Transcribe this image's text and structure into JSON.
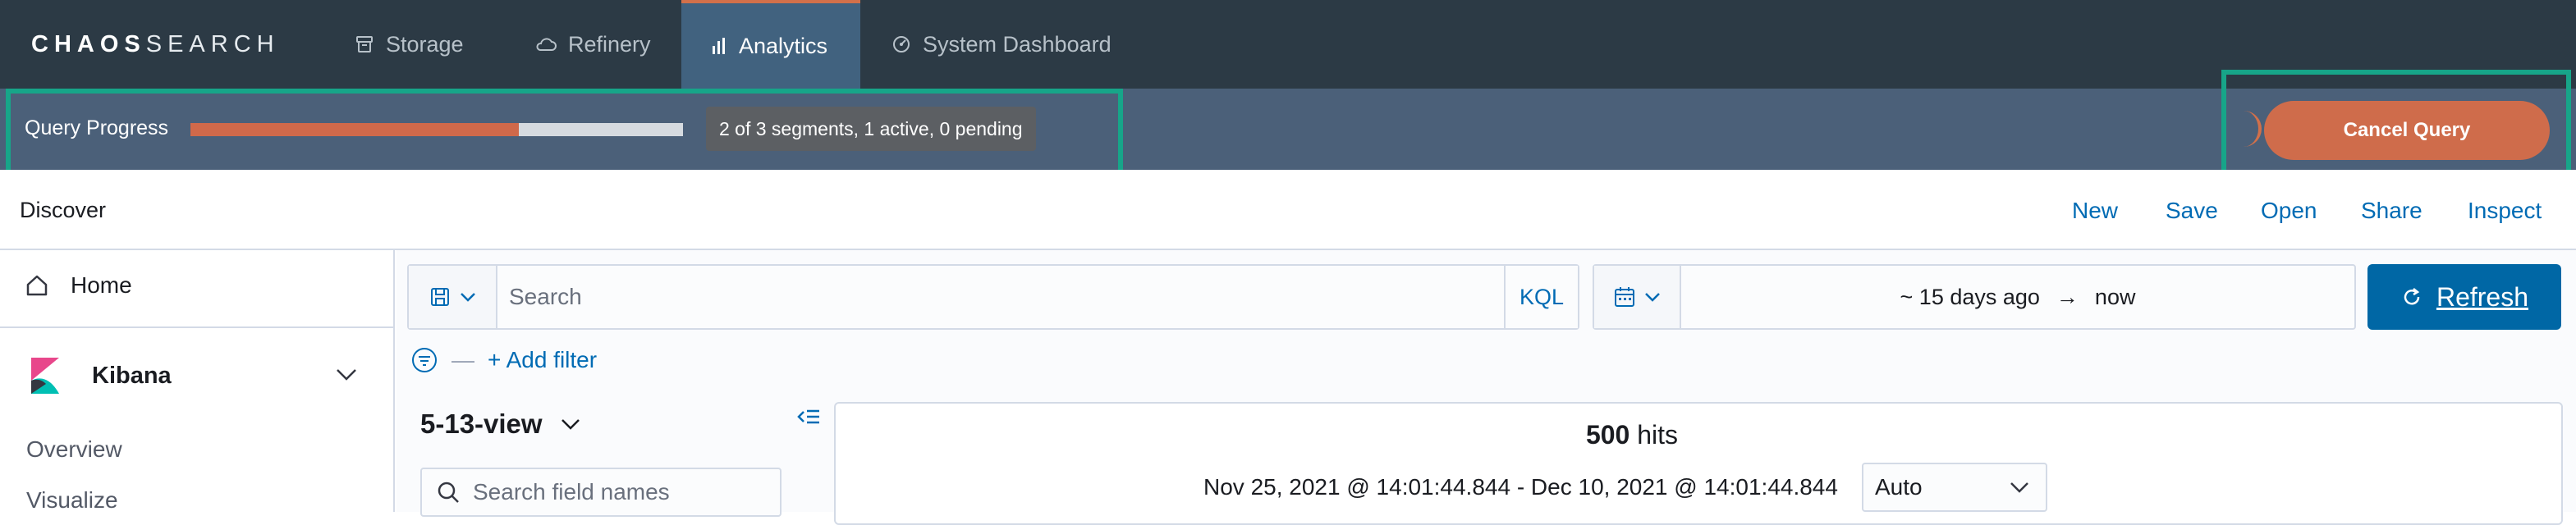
{
  "brand": {
    "logo_bold": "CHAOS",
    "logo_light": "SEARCH"
  },
  "nav": {
    "tabs": [
      {
        "label": "Storage",
        "icon": "storage-icon",
        "active": false
      },
      {
        "label": "Refinery",
        "icon": "cloud-icon",
        "active": false
      },
      {
        "label": "Analytics",
        "icon": "bar-chart-icon",
        "active": true
      },
      {
        "label": "System Dashboard",
        "icon": "dashboard-icon",
        "active": false
      }
    ]
  },
  "query_progress": {
    "label": "Query Progress",
    "fraction": 0.6667,
    "status": "2 of 3 segments, 1 active, 0 pending",
    "cancel_label": "Cancel Query"
  },
  "discover": {
    "title": "Discover",
    "actions": [
      "New",
      "Save",
      "Open",
      "Share",
      "Inspect"
    ]
  },
  "sidebar": {
    "home_label": "Home",
    "app_label": "Kibana",
    "items": [
      "Overview",
      "Visualize"
    ]
  },
  "query_bar": {
    "search_placeholder": "Search",
    "language": "KQL",
    "date_start": "~ 15 days ago",
    "date_arrow": "→",
    "date_end": "now",
    "refresh_label": "Refresh",
    "add_filter_label": "+ Add filter"
  },
  "index_pattern": {
    "name": "5-13-view",
    "field_search_placeholder": "Search field names"
  },
  "results": {
    "hits_count": "500",
    "hits_label": "hits",
    "time_range": "Nov 25, 2021 @ 14:01:44.844 - Dec 10, 2021 @ 14:01:44.844",
    "interval": "Auto"
  },
  "colors": {
    "topnav_bg": "#2c3a45",
    "progress_bg": "#4b6079",
    "accent_orange": "#cf6c4b",
    "highlight_teal": "#17a589",
    "link_blue": "#006bb4",
    "refresh_blue": "#0067a5"
  }
}
